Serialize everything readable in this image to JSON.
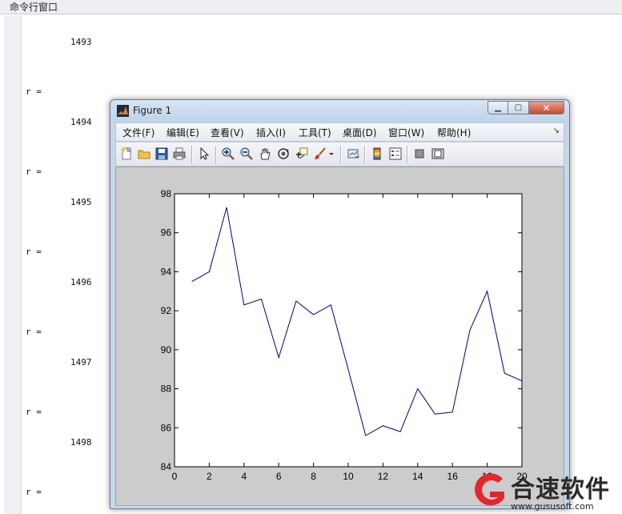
{
  "command_window": {
    "title": "命令行窗口",
    "lines": [
      {
        "kind": "num",
        "text": "1493"
      },
      {
        "kind": "r",
        "text": "r ="
      },
      {
        "kind": "num",
        "text": "1494"
      },
      {
        "kind": "r",
        "text": "r ="
      },
      {
        "kind": "num",
        "text": "1495"
      },
      {
        "kind": "r",
        "text": "r ="
      },
      {
        "kind": "num",
        "text": "1496"
      },
      {
        "kind": "r",
        "text": "r ="
      },
      {
        "kind": "num",
        "text": "1497"
      },
      {
        "kind": "r",
        "text": "r ="
      },
      {
        "kind": "num",
        "text": "1498"
      },
      {
        "kind": "r",
        "text": "r ="
      }
    ]
  },
  "figure": {
    "title": "Figure 1",
    "menu": [
      "文件(F)",
      "编辑(E)",
      "查看(V)",
      "插入(I)",
      "工具(T)",
      "桌面(D)",
      "窗口(W)",
      "帮助(H)"
    ],
    "toolbar_icons": [
      "new-file-icon",
      "open-folder-icon",
      "save-icon",
      "print-icon",
      "pointer-icon",
      "zoom-in-icon",
      "zoom-out-icon",
      "pan-hand-icon",
      "rotate-3d-icon",
      "data-cursor-icon",
      "brush-icon",
      "link-plot-icon",
      "colorbar-icon",
      "legend-icon",
      "hide-plot-tools-icon",
      "show-plot-tools-icon"
    ]
  },
  "chart_data": {
    "type": "line",
    "x": [
      1,
      2,
      3,
      4,
      5,
      6,
      7,
      8,
      9,
      10,
      11,
      12,
      13,
      14,
      15,
      16,
      17,
      18,
      19,
      20
    ],
    "series": [
      {
        "values": [
          93.5,
          94.0,
          97.3,
          92.3,
          92.6,
          89.6,
          92.5,
          91.8,
          92.3,
          89.0,
          85.6,
          86.1,
          85.8,
          88.0,
          86.7,
          86.8,
          91.0,
          93.0,
          88.8,
          88.4
        ]
      }
    ],
    "xlim": [
      0,
      20
    ],
    "ylim": [
      84,
      98
    ],
    "xticks": [
      "0",
      "2",
      "4",
      "6",
      "8",
      "10",
      "12",
      "14",
      "16",
      "18",
      "20"
    ],
    "yticks": [
      "84",
      "86",
      "88",
      "90",
      "92",
      "94",
      "96",
      "98"
    ],
    "line_color": "#00007f",
    "grid": false
  },
  "watermark": {
    "brand": "合速软件",
    "url": "www.gususoft.com",
    "accent": "#e4262c"
  }
}
